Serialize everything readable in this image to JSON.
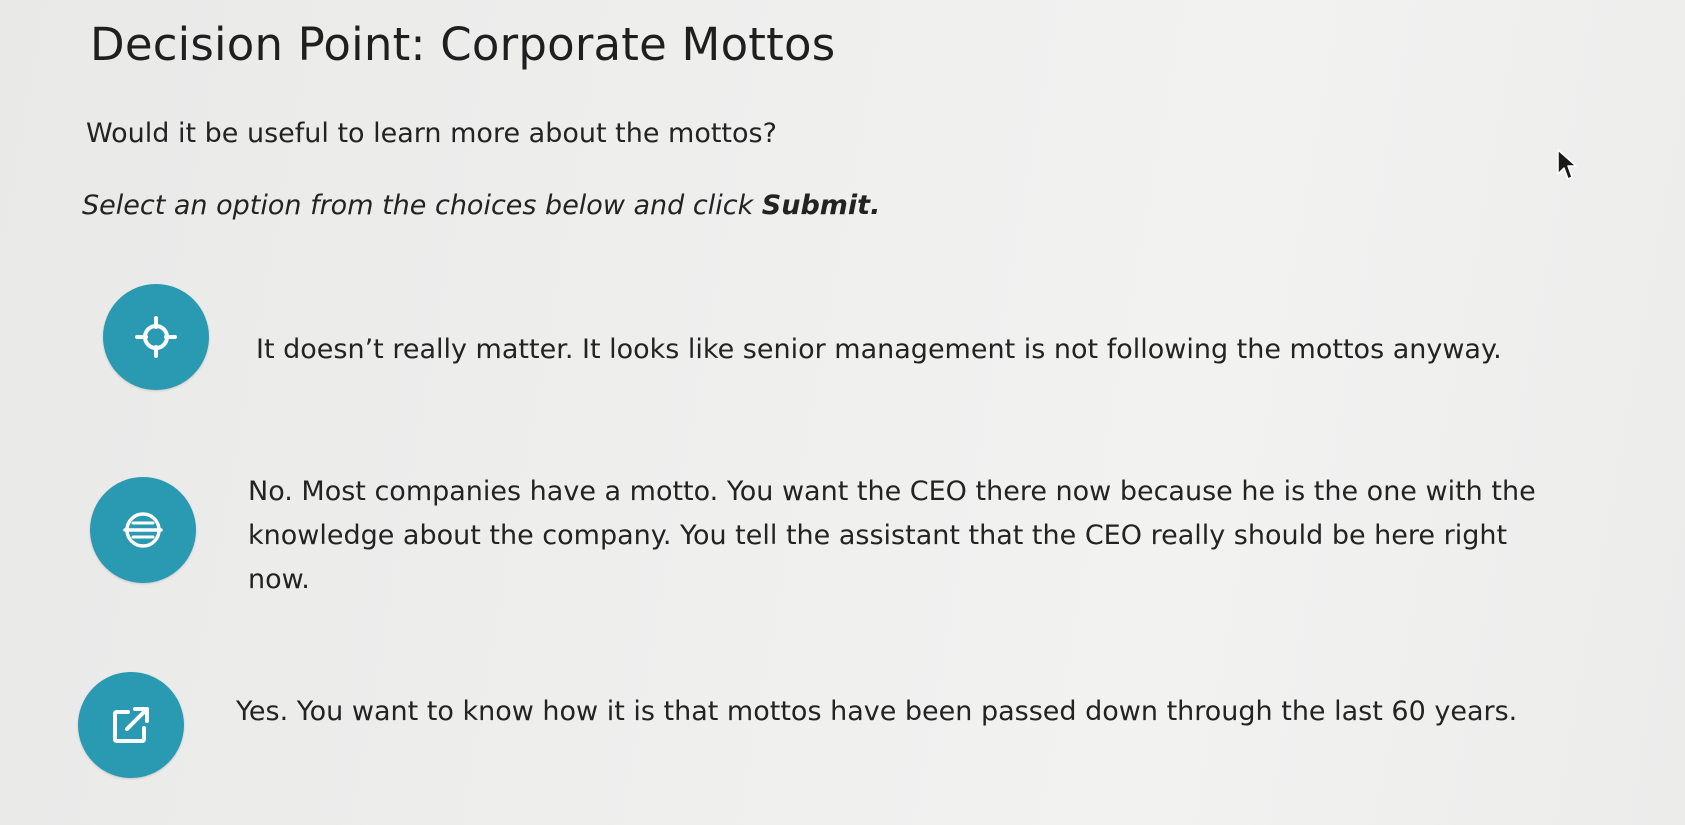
{
  "page": {
    "title": "Decision Point: Corporate Mottos",
    "question": "Would it be useful to learn more about the mottos?",
    "instruction_prefix": "Select an option from the choices below and click ",
    "instruction_emphasis": "Submit."
  },
  "options": [
    {
      "icon": "crosshair-icon",
      "text": "It doesn’t really matter. It looks like senior management is not following the mottos anyway."
    },
    {
      "icon": "strikethrough-circle-icon",
      "text": "No. Most companies have a motto. You want the CEO there now because he is the one with the knowledge about the company. You tell the assistant that the CEO really should be here right now."
    },
    {
      "icon": "external-link-icon",
      "text": "Yes. You want to know how it is that mottos have been passed down through the last 60 years."
    }
  ],
  "colors": {
    "accent": "#2a9ab2",
    "background": "#efefee",
    "text": "#232323"
  }
}
